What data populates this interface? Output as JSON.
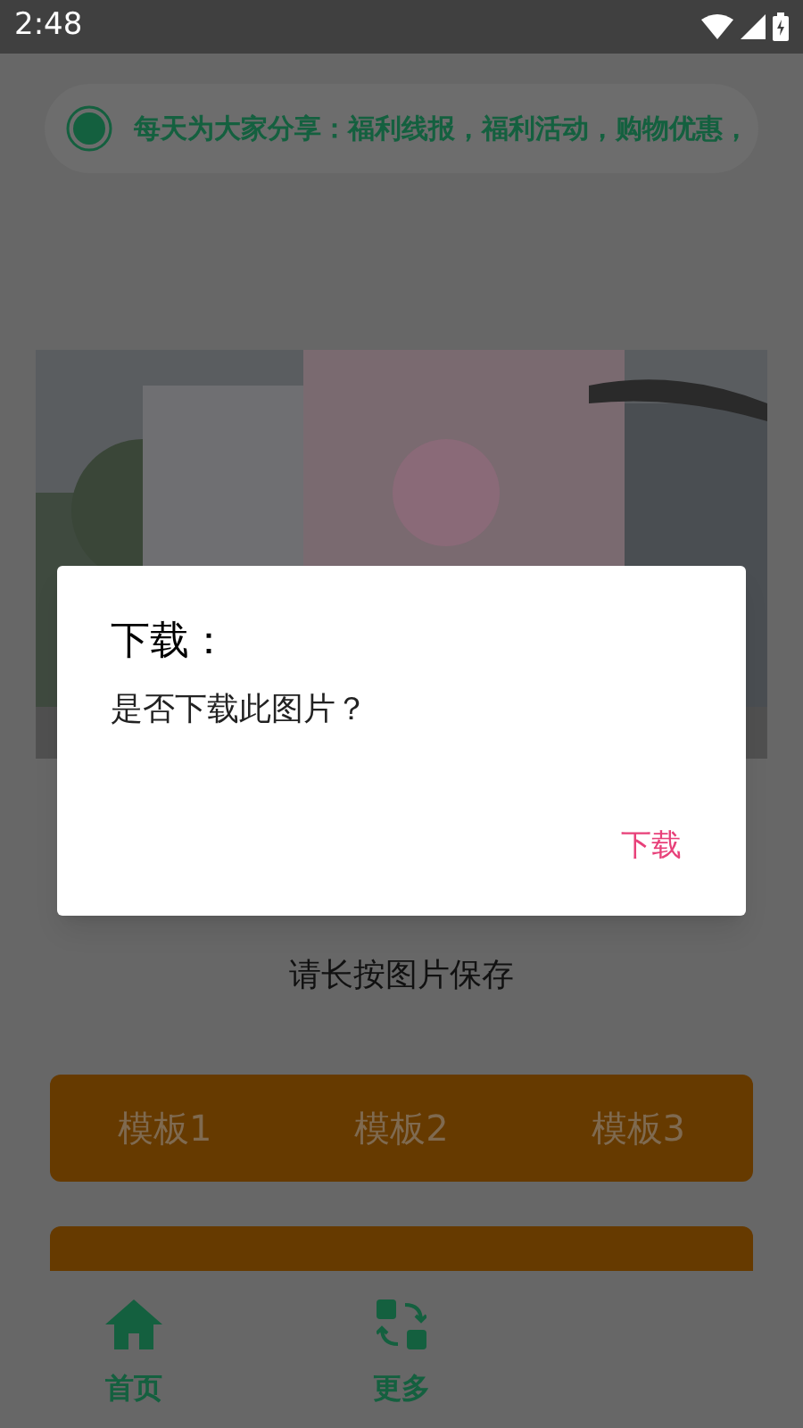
{
  "status_bar": {
    "time": "2:48"
  },
  "notice": {
    "text": "每天为大家分享：福利线报，福利活动，购物优惠，"
  },
  "hint": "请长按图片保存",
  "template_buttons": [
    "模板1",
    "模板2",
    "模板3"
  ],
  "nav_items": [
    {
      "label": "首页",
      "kind": "home"
    },
    {
      "label": "更多",
      "kind": "more"
    }
  ],
  "dialog": {
    "title": "下载：",
    "message": "是否下载此图片？",
    "button": "下载"
  }
}
